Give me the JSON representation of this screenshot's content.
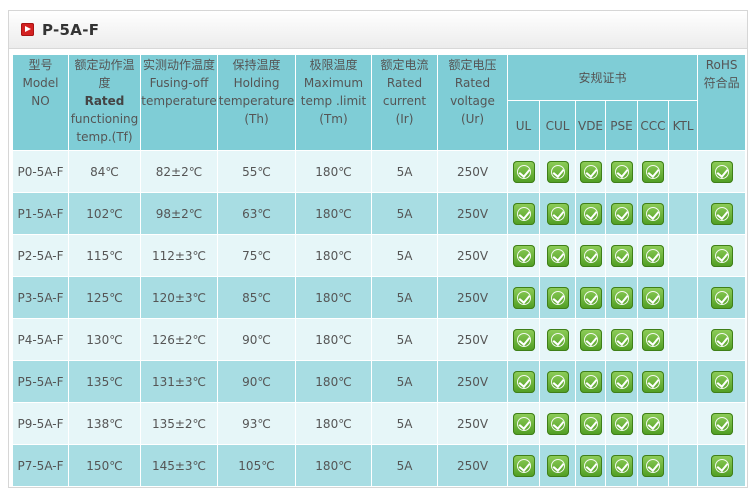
{
  "page": {
    "title": "P-5A-F"
  },
  "headers": {
    "model": {
      "cn": "型号",
      "en1": "Model",
      "en2": "NO"
    },
    "rated_temp": {
      "cn1": "额定动作温",
      "cn2": "度",
      "bold": "Rated",
      "en1": "functioning",
      "en2": "temp.(Tf)"
    },
    "fusing_temp": {
      "cn": "实测动作温度",
      "en1": "Fusing-off",
      "en2": "temperature"
    },
    "holding_temp": {
      "cn": "保持温度",
      "en1": "Holding",
      "en2": "temperature",
      "en3": "(Th)"
    },
    "max_temp": {
      "cn": "极限温度",
      "en1": "Maximum",
      "en2": "temp .limit",
      "en3": "(Tm)"
    },
    "rated_current": {
      "cn": "额定电流",
      "en1": "Rated",
      "en2": "current",
      "en3": "(Ir)"
    },
    "rated_voltage": {
      "cn": "额定电压",
      "en1": "Rated",
      "en2": "voltage",
      "en3": "(Ur)"
    },
    "certifications": {
      "cn": "安规证书",
      "items": [
        "UL",
        "CUL",
        "VDE",
        "PSE",
        "CCC",
        "KTL"
      ]
    },
    "rohs": {
      "en": "RoHS",
      "cn": "符合品"
    }
  },
  "rows": [
    {
      "model": "P0-5A-F",
      "tf": "84℃",
      "fusing": "82±2℃",
      "th": "55℃",
      "tm": "180℃",
      "ir": "5A",
      "ur": "250V",
      "certs": [
        true,
        true,
        true,
        true,
        true,
        false
      ],
      "rohs": true
    },
    {
      "model": "P1-5A-F",
      "tf": "102℃",
      "fusing": "98±2℃",
      "th": "63℃",
      "tm": "180℃",
      "ir": "5A",
      "ur": "250V",
      "certs": [
        true,
        true,
        true,
        true,
        true,
        false
      ],
      "rohs": true
    },
    {
      "model": "P2-5A-F",
      "tf": "115℃",
      "fusing": "112±3℃",
      "th": "75℃",
      "tm": "180℃",
      "ir": "5A",
      "ur": "250V",
      "certs": [
        true,
        true,
        true,
        true,
        true,
        false
      ],
      "rohs": true
    },
    {
      "model": "P3-5A-F",
      "tf": "125℃",
      "fusing": "120±3℃",
      "th": "85℃",
      "tm": "180℃",
      "ir": "5A",
      "ur": "250V",
      "certs": [
        true,
        true,
        true,
        true,
        true,
        false
      ],
      "rohs": true
    },
    {
      "model": "P4-5A-F",
      "tf": "130℃",
      "fusing": "126±2℃",
      "th": "90℃",
      "tm": "180℃",
      "ir": "5A",
      "ur": "250V",
      "certs": [
        true,
        true,
        true,
        true,
        true,
        false
      ],
      "rohs": true
    },
    {
      "model": "P5-5A-F",
      "tf": "135℃",
      "fusing": "131±3℃",
      "th": "90℃",
      "tm": "180℃",
      "ir": "5A",
      "ur": "250V",
      "certs": [
        true,
        true,
        true,
        true,
        true,
        false
      ],
      "rohs": true
    },
    {
      "model": "P9-5A-F",
      "tf": "138℃",
      "fusing": "135±2℃",
      "th": "93℃",
      "tm": "180℃",
      "ir": "5A",
      "ur": "250V",
      "certs": [
        true,
        true,
        true,
        true,
        true,
        false
      ],
      "rohs": true
    },
    {
      "model": "P7-5A-F",
      "tf": "150℃",
      "fusing": "145±3℃",
      "th": "105℃",
      "tm": "180℃",
      "ir": "5A",
      "ur": "250V",
      "certs": [
        true,
        true,
        true,
        true,
        true,
        false
      ],
      "rohs": true
    }
  ],
  "icons": {
    "title_icon": "play-square-icon",
    "cert_icon": "certified-check-icon"
  },
  "colors": {
    "header_bg": "#7fcdd6",
    "row_light": "#e6f6f8",
    "row_dark": "#a8dde3",
    "check_green": "#5aa82a",
    "title_icon_red": "#d42121"
  }
}
